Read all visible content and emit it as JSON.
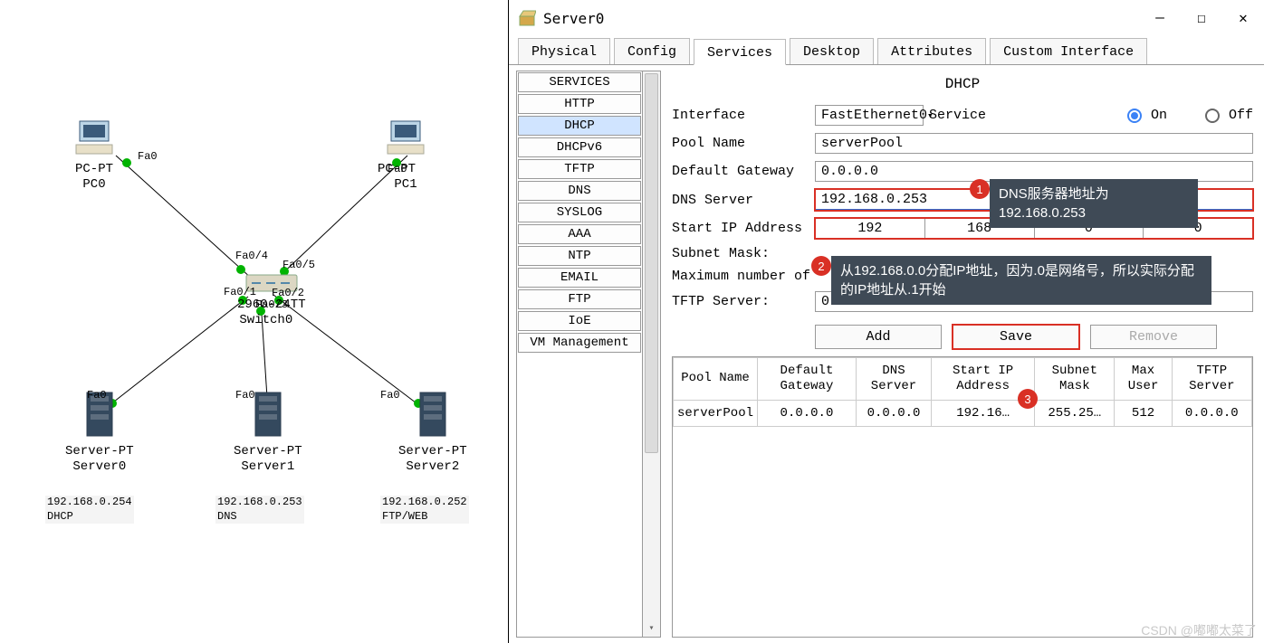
{
  "topology": {
    "devices": {
      "pc0": {
        "type": "PC-PT",
        "name": "PC0",
        "port": "Fa0"
      },
      "pc1": {
        "type": "PC-PT",
        "name": "PC1",
        "port": "Fa0"
      },
      "switch": {
        "type": "2960-24TT",
        "name": "Switch0",
        "ports": [
          "Fa0/4",
          "Fa0/5",
          "Fa0/1",
          "Fa0/3",
          "Fa0/2"
        ]
      },
      "server0": {
        "type": "Server-PT",
        "name": "Server0",
        "port": "Fa0"
      },
      "server1": {
        "type": "Server-PT",
        "name": "Server1",
        "port": "Fa0"
      },
      "server2": {
        "type": "Server-PT",
        "name": "Server2",
        "port": "Fa0"
      }
    },
    "ip_labels": {
      "server0": {
        "ip": "192.168.0.254",
        "role": "DHCP"
      },
      "server1": {
        "ip": "192.168.0.253",
        "role": "DNS"
      },
      "server2": {
        "ip": "192.168.0.252",
        "role": "FTP/WEB"
      }
    }
  },
  "window": {
    "title": "Server0",
    "tabs": [
      "Physical",
      "Config",
      "Services",
      "Desktop",
      "Attributes",
      "Custom Interface"
    ],
    "active_tab": "Services"
  },
  "services_list": [
    "SERVICES",
    "HTTP",
    "DHCP",
    "DHCPv6",
    "TFTP",
    "DNS",
    "SYSLOG",
    "AAA",
    "NTP",
    "EMAIL",
    "FTP",
    "IoE",
    "VM Management"
  ],
  "selected_service": "DHCP",
  "dhcp": {
    "title": "DHCP",
    "interface_label": "Interface",
    "interface_value": "FastEthernet0",
    "service_label": "Service",
    "on_label": "On",
    "off_label": "Off",
    "service_on": true,
    "pool_name_label": "Pool Name",
    "pool_name_value": "serverPool",
    "default_gateway_label": "Default Gateway",
    "default_gateway_value": "0.0.0.0",
    "dns_server_label": "DNS Server",
    "dns_server_value": "192.168.0.253",
    "start_ip_label": "Start IP Address",
    "start_ip": [
      "192",
      "168",
      "0",
      "0"
    ],
    "subnet_label": "Subnet Mask:",
    "max_users_label": "Maximum number of",
    "tftp_label": "TFTP Server:",
    "tftp_value": "0.0.0.0",
    "buttons": {
      "add": "Add",
      "save": "Save",
      "remove": "Remove"
    }
  },
  "table": {
    "headers": [
      "Pool Name",
      "Default Gateway",
      "DNS Server",
      "Start IP Address",
      "Subnet Mask",
      "Max User",
      "TFTP Server"
    ],
    "rows": [
      {
        "pool": "serverPool",
        "gw": "0.0.0.0",
        "dns": "0.0.0.0",
        "start": "192.16…",
        "mask": "255.25…",
        "max": "512",
        "tftp": "0.0.0.0"
      }
    ]
  },
  "annotations": {
    "a1": "DNS服务器地址为192.168.0.253",
    "a2": "从192.168.0.0分配IP地址，因为.0是网络号，所以实际分配的IP地址从.1开始"
  },
  "watermark": "CSDN @嘟嘟太菜了"
}
